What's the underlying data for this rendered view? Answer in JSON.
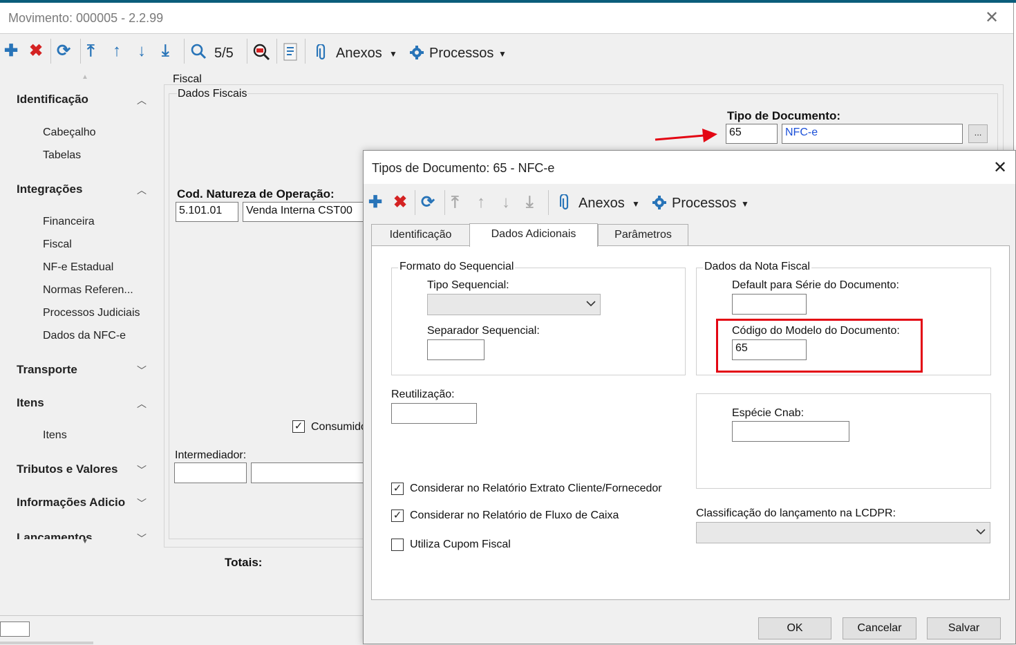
{
  "main_window": {
    "title": "Movimento: 000005 - 2.2.99",
    "close_glyph": "✕",
    "toolbar": {
      "record_counter": "5/5",
      "anexos_label": "Anexos",
      "processos_label": "Processos"
    },
    "sidebar": {
      "groups": [
        {
          "label": "Identificação",
          "items": [
            "Cabeçalho",
            "Tabelas"
          ]
        },
        {
          "label": "Integrações",
          "items": [
            "Financeira",
            "Fiscal",
            "NF-e Estadual",
            "Normas Referen...",
            "Processos Judiciais",
            "Dados da NFC-e"
          ]
        },
        {
          "label": "Transporte",
          "items": []
        },
        {
          "label": "Itens",
          "items": [
            "Itens"
          ]
        },
        {
          "label": "Tributos e Valores",
          "items": []
        },
        {
          "label": "Informações Adicio",
          "items": []
        },
        {
          "label": "Lançamentos",
          "items": []
        }
      ]
    },
    "content": {
      "section_title": "Fiscal",
      "subsection_title": "Dados Fiscais",
      "tipo_documento_label": "Tipo de Documento:",
      "tipo_documento_code": "65",
      "tipo_documento_name": "NFC-e",
      "lookup_button_label": "...",
      "natureza_label": "Cod. Natureza de Operação:",
      "natureza_code": "5.101.01",
      "natureza_desc": "Venda Interna CST00",
      "consumidor_label": "Consumido",
      "intermediador_label": "Intermediador:",
      "totais_label": "Totais:"
    }
  },
  "dialog": {
    "title": "Tipos de Documento: 65 - NFC-e",
    "close_glyph": "✕",
    "toolbar": {
      "anexos_label": "Anexos",
      "processos_label": "Processos"
    },
    "tabs": [
      {
        "label": "Identificação",
        "active": false
      },
      {
        "label": "Dados Adicionais",
        "active": true
      },
      {
        "label": "Parâmetros",
        "active": false
      }
    ],
    "formato_sequencial": {
      "legend": "Formato do Sequencial",
      "tipo_sequencial_label": "Tipo Sequencial:",
      "tipo_sequencial_value": "",
      "separador_label": "Separador Sequencial:",
      "separador_value": ""
    },
    "dados_nota_fiscal": {
      "legend": "Dados da Nota Fiscal",
      "serie_label": "Default para Série do Documento:",
      "serie_value": "",
      "modelo_label": "Código do Modelo do Documento:",
      "modelo_value": "65"
    },
    "reutilizacao_label": "Reutilização:",
    "reutilizacao_value": "",
    "especie_cnab_label": "Espécie Cnab:",
    "especie_cnab_value": "",
    "checkboxes": [
      {
        "label": "Considerar no Relatório Extrato Cliente/Fornecedor",
        "checked": true
      },
      {
        "label": "Considerar no Relatório de Fluxo de Caixa",
        "checked": true
      },
      {
        "label": "Utiliza Cupom Fiscal",
        "checked": false
      }
    ],
    "lcdpr_label": "Classificação do lançamento na LCDPR:",
    "lcdpr_value": "",
    "buttons": {
      "ok": "OK",
      "cancel": "Cancelar",
      "save": "Salvar"
    }
  },
  "colors": {
    "highlight_red": "#e30613",
    "arrow_red": "#e30613",
    "icon_blue": "#2874b8",
    "icon_red": "#d42222"
  }
}
